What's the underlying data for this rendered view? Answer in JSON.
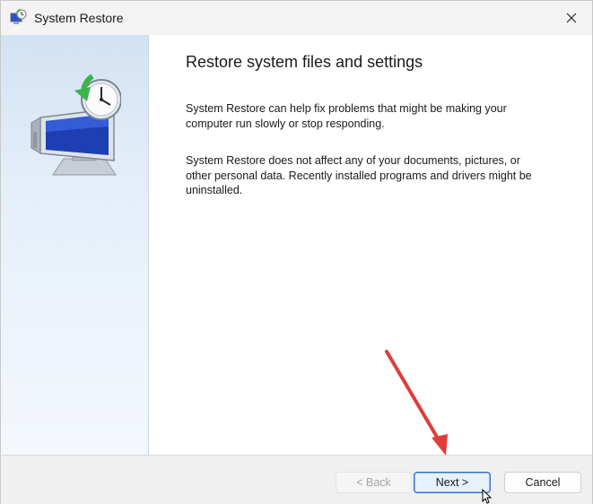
{
  "window": {
    "title": "System Restore"
  },
  "titlebar": {
    "close_icon": "close-icon",
    "app_icon": "system-restore-icon"
  },
  "sidebar": {
    "illustration": "monitor-clock-restore-icon"
  },
  "content": {
    "heading": "Restore system files and settings",
    "paragraph1_line1": "System Restore can help fix problems that might be making your",
    "paragraph1_line2": "computer run slowly or stop responding.",
    "paragraph2_line1": "System Restore does not affect any of your documents, pictures, or",
    "paragraph2_line2": "other personal data. Recently installed programs and drivers might be",
    "paragraph2_line3": "uninstalled."
  },
  "footer": {
    "back_label": "< Back",
    "next_label": "Next >",
    "cancel_label": "Cancel"
  },
  "annotation": {
    "arrow_color": "#e03c3c"
  }
}
